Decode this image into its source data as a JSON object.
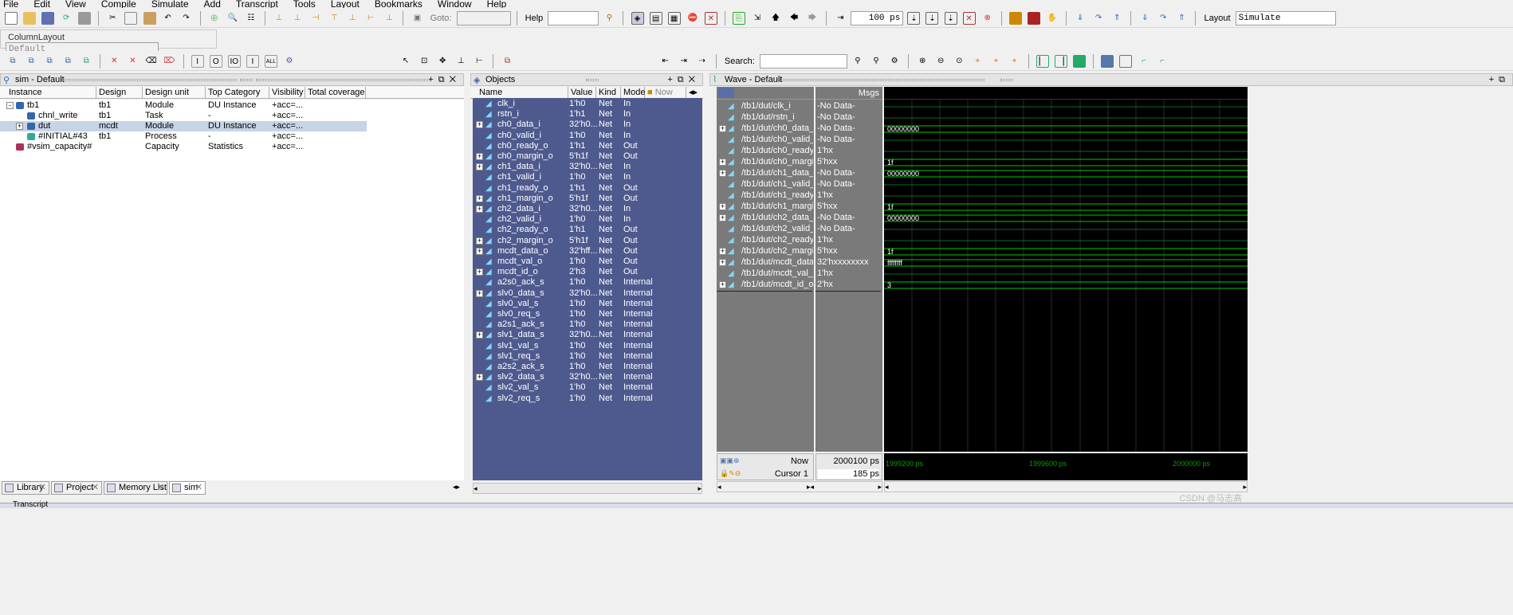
{
  "menu": [
    "File",
    "Edit",
    "View",
    "Compile",
    "Simulate",
    "Add",
    "Transcript",
    "Tools",
    "Layout",
    "Bookmarks",
    "Window",
    "Help"
  ],
  "toolbar": {
    "goto_label": "Goto:",
    "help_label": "Help",
    "run_length": "100 ps",
    "layout_label": "Layout",
    "layout_value": "Simulate",
    "column_layout_label": "ColumnLayout",
    "column_layout_value": "Default",
    "search_label": "Search:"
  },
  "sim_pane": {
    "title": "sim - Default",
    "columns": [
      "Instance",
      "Design unit",
      "Design unit type",
      "Top Category",
      "Visibility",
      "Total coverage"
    ],
    "rows": [
      {
        "instance": "tb1",
        "unit": "tb1",
        "type": "Module",
        "category": "DU Instance",
        "visibility": "+acc=...",
        "expander": "-"
      },
      {
        "instance": "chnl_write",
        "unit": "tb1",
        "type": "Task",
        "category": "-",
        "visibility": "+acc=...",
        "expander": ""
      },
      {
        "instance": "dut",
        "unit": "mcdt",
        "type": "Module",
        "category": "DU Instance",
        "visibility": "+acc=...",
        "expander": "+"
      },
      {
        "instance": "#INITIAL#43",
        "unit": "tb1",
        "type": "Process",
        "category": "-",
        "visibility": "+acc=...",
        "expander": ""
      },
      {
        "instance": "#vsim_capacity#",
        "unit": "",
        "type": "Capacity",
        "category": "Statistics",
        "visibility": "+acc=...",
        "expander": ""
      }
    ]
  },
  "objects_pane": {
    "title": "Objects",
    "columns": [
      "Name",
      "Value",
      "Kind",
      "Mode",
      "Now"
    ],
    "rows": [
      {
        "name": "clk_i",
        "value": "1'h0",
        "kind": "Net",
        "mode": "In",
        "exp": false
      },
      {
        "name": "rstn_i",
        "value": "1'h1",
        "kind": "Net",
        "mode": "In",
        "exp": false
      },
      {
        "name": "ch0_data_i",
        "value": "32'h0...",
        "kind": "Net",
        "mode": "In",
        "exp": true
      },
      {
        "name": "ch0_valid_i",
        "value": "1'h0",
        "kind": "Net",
        "mode": "In",
        "exp": false
      },
      {
        "name": "ch0_ready_o",
        "value": "1'h1",
        "kind": "Net",
        "mode": "Out",
        "exp": false
      },
      {
        "name": "ch0_margin_o",
        "value": "5'h1f",
        "kind": "Net",
        "mode": "Out",
        "exp": true
      },
      {
        "name": "ch1_data_i",
        "value": "32'h0...",
        "kind": "Net",
        "mode": "In",
        "exp": true
      },
      {
        "name": "ch1_valid_i",
        "value": "1'h0",
        "kind": "Net",
        "mode": "In",
        "exp": false
      },
      {
        "name": "ch1_ready_o",
        "value": "1'h1",
        "kind": "Net",
        "mode": "Out",
        "exp": false
      },
      {
        "name": "ch1_margin_o",
        "value": "5'h1f",
        "kind": "Net",
        "mode": "Out",
        "exp": true
      },
      {
        "name": "ch2_data_i",
        "value": "32'h0...",
        "kind": "Net",
        "mode": "In",
        "exp": true
      },
      {
        "name": "ch2_valid_i",
        "value": "1'h0",
        "kind": "Net",
        "mode": "In",
        "exp": false
      },
      {
        "name": "ch2_ready_o",
        "value": "1'h1",
        "kind": "Net",
        "mode": "Out",
        "exp": false
      },
      {
        "name": "ch2_margin_o",
        "value": "5'h1f",
        "kind": "Net",
        "mode": "Out",
        "exp": true
      },
      {
        "name": "mcdt_data_o",
        "value": "32'hff...",
        "kind": "Net",
        "mode": "Out",
        "exp": true
      },
      {
        "name": "mcdt_val_o",
        "value": "1'h0",
        "kind": "Net",
        "mode": "Out",
        "exp": false
      },
      {
        "name": "mcdt_id_o",
        "value": "2'h3",
        "kind": "Net",
        "mode": "Out",
        "exp": true
      },
      {
        "name": "a2s0_ack_s",
        "value": "1'h0",
        "kind": "Net",
        "mode": "Internal",
        "exp": false
      },
      {
        "name": "slv0_data_s",
        "value": "32'h0...",
        "kind": "Net",
        "mode": "Internal",
        "exp": true
      },
      {
        "name": "slv0_val_s",
        "value": "1'h0",
        "kind": "Net",
        "mode": "Internal",
        "exp": false
      },
      {
        "name": "slv0_req_s",
        "value": "1'h0",
        "kind": "Net",
        "mode": "Internal",
        "exp": false
      },
      {
        "name": "a2s1_ack_s",
        "value": "1'h0",
        "kind": "Net",
        "mode": "Internal",
        "exp": false
      },
      {
        "name": "slv1_data_s",
        "value": "32'h0...",
        "kind": "Net",
        "mode": "Internal",
        "exp": true
      },
      {
        "name": "slv1_val_s",
        "value": "1'h0",
        "kind": "Net",
        "mode": "Internal",
        "exp": false
      },
      {
        "name": "slv1_req_s",
        "value": "1'h0",
        "kind": "Net",
        "mode": "Internal",
        "exp": false
      },
      {
        "name": "a2s2_ack_s",
        "value": "1'h0",
        "kind": "Net",
        "mode": "Internal",
        "exp": false
      },
      {
        "name": "slv2_data_s",
        "value": "32'h0...",
        "kind": "Net",
        "mode": "Internal",
        "exp": true
      },
      {
        "name": "slv2_val_s",
        "value": "1'h0",
        "kind": "Net",
        "mode": "Internal",
        "exp": false
      },
      {
        "name": "slv2_req_s",
        "value": "1'h0",
        "kind": "Net",
        "mode": "Internal",
        "exp": false
      }
    ]
  },
  "wave_pane": {
    "title": "Wave - Default",
    "msgs_label": "Msgs",
    "signals": [
      {
        "path": "/tb1/dut/clk_i",
        "msg": "-No Data-",
        "wave": "",
        "exp": false
      },
      {
        "path": "/tb1/dut/rstn_i",
        "msg": "-No Data-",
        "wave": "",
        "exp": false
      },
      {
        "path": "/tb1/dut/ch0_data_i",
        "msg": "-No Data-",
        "wave": "00000000",
        "exp": true
      },
      {
        "path": "/tb1/dut/ch0_valid_i",
        "msg": "-No Data-",
        "wave": "",
        "exp": false
      },
      {
        "path": "/tb1/dut/ch0_ready_o",
        "msg": "1'hx",
        "wave": "",
        "exp": false
      },
      {
        "path": "/tb1/dut/ch0_margi...",
        "msg": "5'hxx",
        "wave": "1f",
        "exp": true
      },
      {
        "path": "/tb1/dut/ch1_data_i",
        "msg": "-No Data-",
        "wave": "00000000",
        "exp": true
      },
      {
        "path": "/tb1/dut/ch1_valid_i",
        "msg": "-No Data-",
        "wave": "",
        "exp": false
      },
      {
        "path": "/tb1/dut/ch1_ready_o",
        "msg": "1'hx",
        "wave": "",
        "exp": false
      },
      {
        "path": "/tb1/dut/ch1_margi...",
        "msg": "5'hxx",
        "wave": "1f",
        "exp": true
      },
      {
        "path": "/tb1/dut/ch2_data_i",
        "msg": "-No Data-",
        "wave": "00000000",
        "exp": true
      },
      {
        "path": "/tb1/dut/ch2_valid_i",
        "msg": "-No Data-",
        "wave": "",
        "exp": false
      },
      {
        "path": "/tb1/dut/ch2_ready_o",
        "msg": "1'hx",
        "wave": "",
        "exp": false
      },
      {
        "path": "/tb1/dut/ch2_margi...",
        "msg": "5'hxx",
        "wave": "1f",
        "exp": true
      },
      {
        "path": "/tb1/dut/mcdt_data_o",
        "msg": "32'hxxxxxxxx",
        "wave": "ffffffff",
        "exp": true
      },
      {
        "path": "/tb1/dut/mcdt_val_o",
        "msg": "1'hx",
        "wave": "",
        "exp": false
      },
      {
        "path": "/tb1/dut/mcdt_id_o",
        "msg": "2'hx",
        "wave": "3",
        "exp": true
      }
    ],
    "now_label": "Now",
    "now_value": "2000100 ps",
    "cursor_label": "Cursor 1",
    "cursor_value": "185 ps",
    "timeline": [
      "1999200 ps",
      "1999600 ps",
      "2000000 ps"
    ]
  },
  "tabs": [
    {
      "label": "Library"
    },
    {
      "label": "Project"
    },
    {
      "label": "Memory List"
    },
    {
      "label": "sim"
    }
  ],
  "transcript_label": "Transcript",
  "watermark": "CSDN @马志高",
  "colors": {
    "objects_bg": "#4e5a8e",
    "wave_bg": "#000000",
    "wave_green": "#00c800",
    "names_bg": "#7a7a7a"
  }
}
